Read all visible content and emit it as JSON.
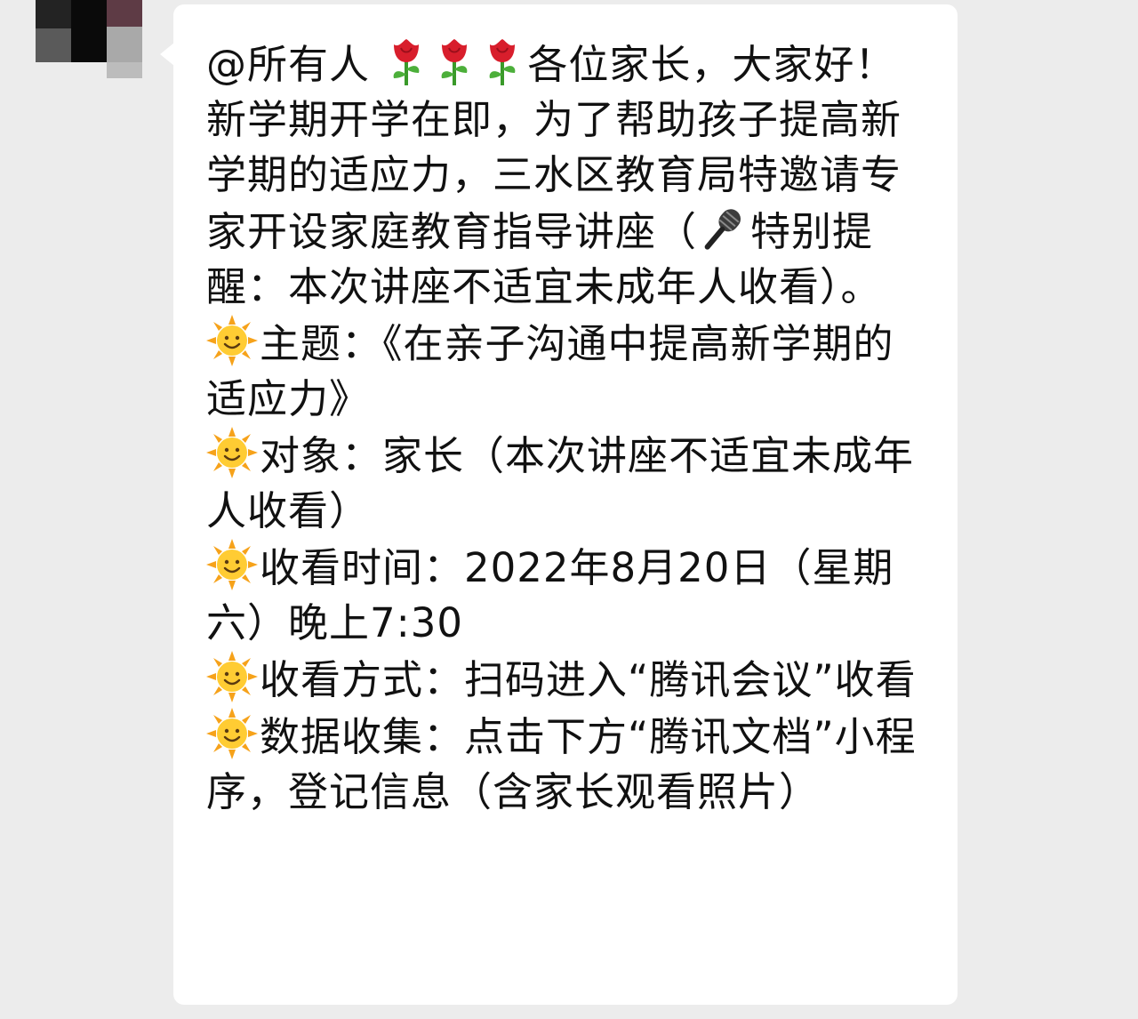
{
  "message": {
    "lines": [
      "@所有人 ",
      "各位家长，大家好！新学期开学在即，为了帮助孩子提高新学期的适应力，三水区教育局特邀请专家开设家庭教育指导讲座（",
      "特别提醒：本次讲座不适宜未成年人收看）。",
      "主题：《在亲子沟通中提高新学期的适应力》",
      "对象：家长（本次讲座不适宜未成年人收看）",
      "收看时间：2022年8月20日（星期六）晚上7:30",
      "收看方式：扫码进入“腾讯会议”收看",
      "数据收集：点击下方“腾讯文档”小程序，登记信息（含家长观看照片）"
    ],
    "icons": {
      "mention_decoration": "rose-icon",
      "mic": "microphone-icon",
      "bullet": "sun-with-face-icon"
    }
  },
  "colors": {
    "page_background": "#ececec",
    "bubble_background": "#ffffff",
    "text": "#111111"
  }
}
